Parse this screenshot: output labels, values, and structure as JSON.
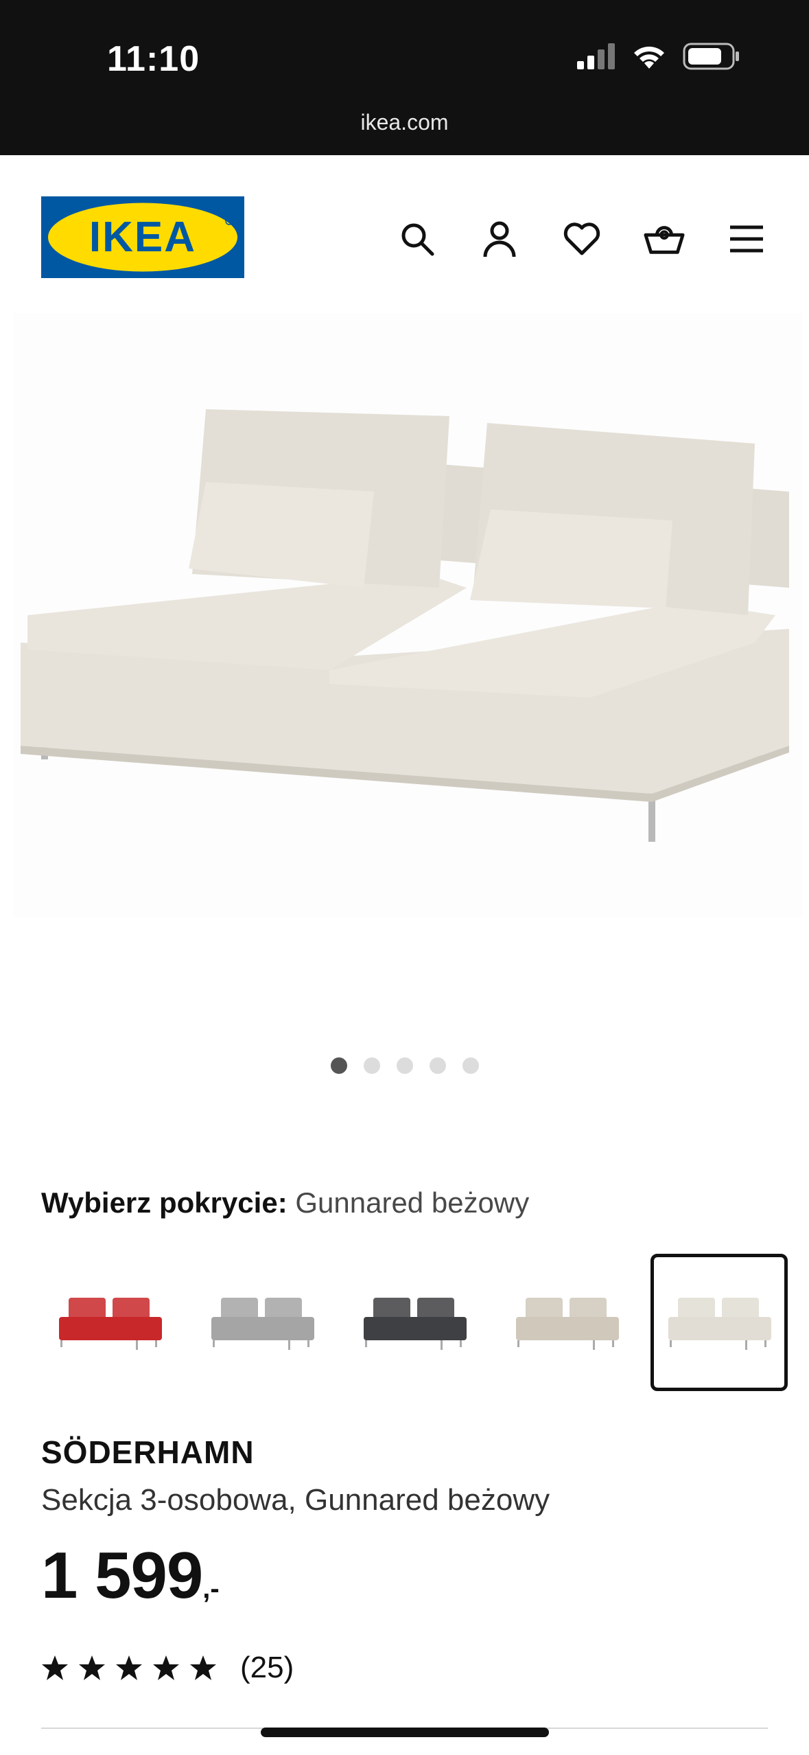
{
  "status_bar": {
    "time": "11:10",
    "url": "ikea.com"
  },
  "header": {
    "logo_text": "IKEA",
    "icons": [
      "search-icon",
      "account-icon",
      "heart-icon",
      "cart-icon",
      "menu-icon"
    ]
  },
  "gallery": {
    "dot_count": 5,
    "active_index": 0
  },
  "product": {
    "cover_label": "Wybierz pokrycie:",
    "cover_value": "Gunnared beżowy",
    "swatches": [
      {
        "color": "#c8282a",
        "label": "red"
      },
      {
        "color": "#a5a5a5",
        "label": "light grey"
      },
      {
        "color": "#3f4043",
        "label": "dark grey"
      },
      {
        "color": "#cfc8bb",
        "label": "beige"
      },
      {
        "color": "#e1ddd4",
        "label": "light beige",
        "selected": true
      }
    ],
    "name": "SÖDERHAMN",
    "description": "Sekcja 3-osobowa, Gunnared beżowy",
    "price": "1 599",
    "price_suffix": ",-",
    "rating_stars": 5,
    "review_count": "(25)"
  },
  "colors": {
    "ikea_blue": "#0058a3",
    "ikea_yellow": "#ffdb00",
    "sofa": "#e4e0d8"
  }
}
